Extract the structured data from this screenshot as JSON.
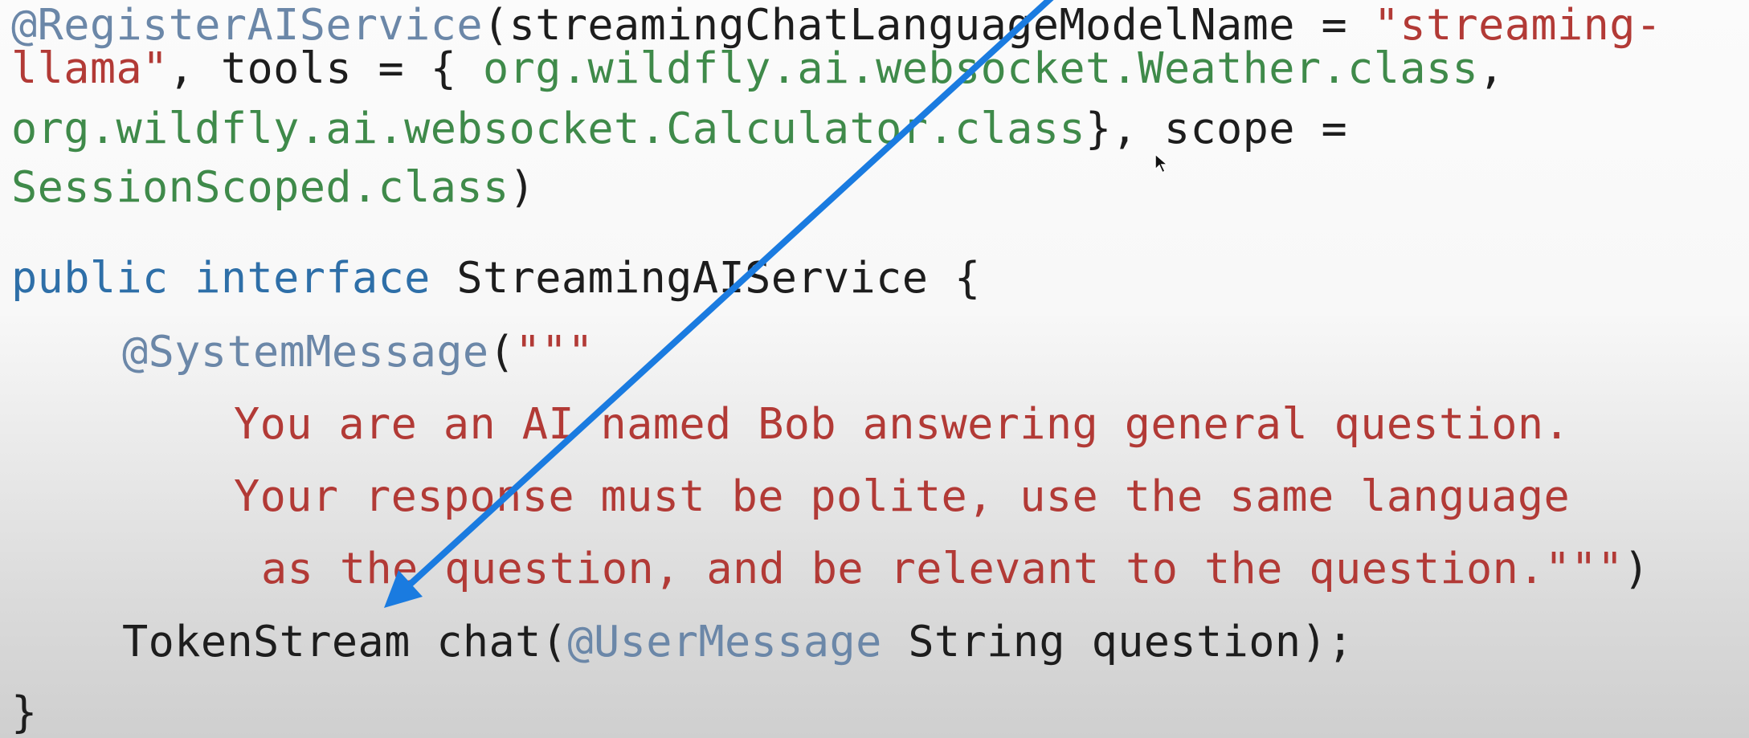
{
  "code": {
    "line1": {
      "annotation": "@RegisterAIService",
      "open": "(streamingChatLanguageModelName = ",
      "string": "\"streaming-"
    },
    "line2": {
      "string": "llama\"",
      "rest": ", tools = { ",
      "class1": "org.wildfly.ai.websocket.Weather.class",
      "comma": ","
    },
    "line3": {
      "class2": "org.wildfly.ai.websocket.Calculator.class",
      "rest": "}, scope ="
    },
    "line4": {
      "class3": "SessionScoped.class",
      "close": ")"
    },
    "line5": {
      "kw1": "public",
      "space": " ",
      "kw2": "interface",
      "rest": " StreamingAIService {"
    },
    "line6": {
      "annotation": "@SystemMessage",
      "open": "(",
      "string": "\"\"\""
    },
    "line7": {
      "string": "You are an AI named Bob answering general question."
    },
    "line8": {
      "string": "Your response must be polite, use the same language"
    },
    "line9": {
      "string": "as the question, and be relevant to the question.\"\"\"",
      "close": ")"
    },
    "line10": {
      "type": "TokenStream chat(",
      "annotation": "@UserMessage",
      "rest": " String question);"
    },
    "line11": {
      "brace": "}"
    }
  },
  "colors": {
    "annotation": "#6b87a8",
    "string": "#b23a36",
    "class_literal": "#3f8a4a",
    "keyword": "#2e6fa8",
    "plain": "#1d1d1d",
    "arrow": "#1a7be0"
  },
  "overlay": {
    "arrow_icon": "blue-arrow-icon",
    "cursor_icon": "mouse-pointer-icon"
  }
}
